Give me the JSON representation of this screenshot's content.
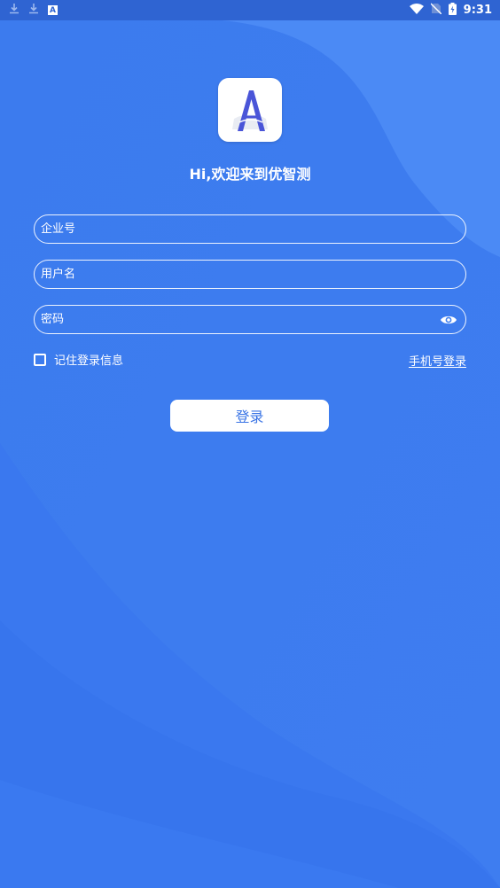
{
  "status_bar": {
    "time": "9:31",
    "left_icons": [
      "download-icon",
      "download-icon",
      "app-a-icon"
    ],
    "app_icon_letter": "A",
    "right_icons": [
      "wifi-icon",
      "no-sim-icon",
      "battery-charging-icon"
    ]
  },
  "welcome_text": "Hi,欢迎来到优智测",
  "logo_letter": "A",
  "form": {
    "company_placeholder": "企业号",
    "username_placeholder": "用户名",
    "password_placeholder": "密码",
    "remember_label": "记住登录信息",
    "phone_login_label": "手机号登录",
    "login_button": "登录"
  },
  "colors": {
    "background": "#3f7ff0",
    "status_bar": "#2f64d2",
    "button_text": "#3a74e5",
    "logo_accent": "#4a55d8"
  }
}
